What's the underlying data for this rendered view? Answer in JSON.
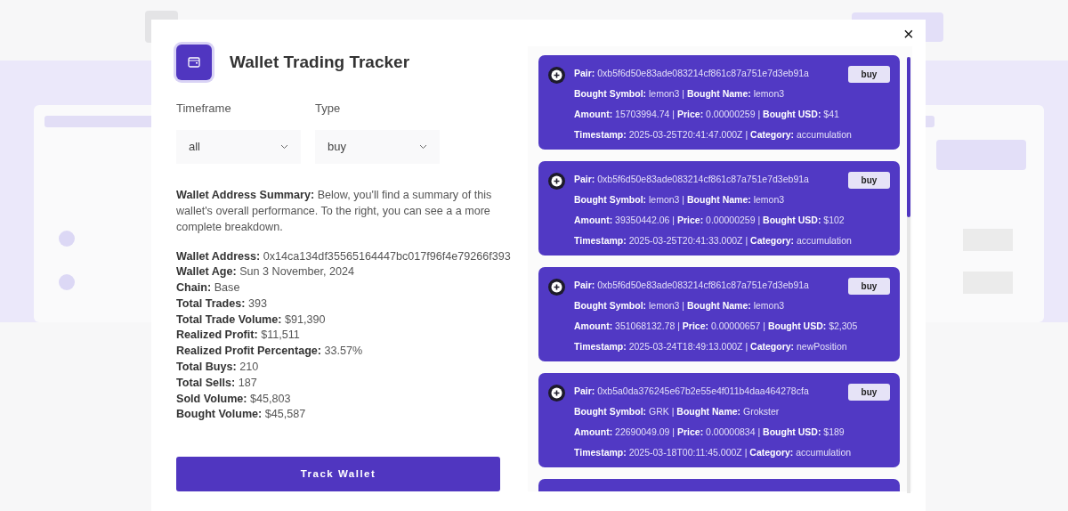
{
  "modal": {
    "title": "Wallet Trading Tracker",
    "filters": [
      {
        "label": "Timeframe",
        "value": "all"
      },
      {
        "label": "Type",
        "value": "buy"
      }
    ],
    "summary": "**Wallet Address Summary:** Below, you'll find a summary of this wallet's overall performance. To the right, you can see a a more complete breakdown.",
    "stats": [
      {
        "label": "Wallet Address:",
        "value": "0x14ca134df35565164447bc017f96f4e79266f393"
      },
      {
        "label": "Wallet Age:",
        "value": "Sun 3 November, 2024"
      },
      {
        "label": "Chain:",
        "value": "Base"
      },
      {
        "label": "Total Trades:",
        "value": "393"
      },
      {
        "label": "Total Trade Volume:",
        "value": "$91,390"
      },
      {
        "label": "Realized Profit:",
        "value": "$11,511"
      },
      {
        "label": "Realized Profit Percentage:",
        "value": "33.57%"
      },
      {
        "label": "Total Buys:",
        "value": "210"
      },
      {
        "label": "Total Sells:",
        "value": "187"
      },
      {
        "label": "Sold Volume:",
        "value": "$45,803"
      },
      {
        "label": "Bought Volume:",
        "value": "$45,587"
      }
    ],
    "action": "Track Wallet",
    "close": "×",
    "trades": [
      {
        "kind": "full",
        "badge": "buy",
        "lines": [
          "**Pair:** 0xb5f6d50e83ade083214cf861c87a751e7d3eb91a",
          "**Bought Symbol:** lemon3 | **Bought Name:** lemon3",
          "**Amount:** 15703994.74 | **Price:** 0.00000259 | **Bought USD:** $41",
          "**Timestamp:** 2025-03-25T20:41:47.000Z | **Category:** accumulation"
        ]
      },
      {
        "kind": "full",
        "badge": "buy",
        "lines": [
          "**Pair:** 0xb5f6d50e83ade083214cf861c87a751e7d3eb91a",
          "**Bought Symbol:** lemon3 | **Bought Name:** lemon3",
          "**Amount:** 39350442.06 | **Price:** 0.00000259 | **Bought USD:** $102",
          "**Timestamp:** 2025-03-25T20:41:33.000Z | **Category:** accumulation"
        ]
      },
      {
        "kind": "full",
        "badge": "buy",
        "lines": [
          "**Pair:** 0xb5f6d50e83ade083214cf861c87a751e7d3eb91a",
          "**Bought Symbol:** lemon3 | **Bought Name:** lemon3",
          "**Amount:** 351068132.78 | **Price:** 0.00000657 | **Bought USD:** $2,305",
          "**Timestamp:** 2025-03-24T18:49:13.000Z | **Category:** newPosition"
        ]
      },
      {
        "kind": "full",
        "badge": "buy",
        "lines": [
          "**Pair:** 0xb5a0da376245e67b2e55e4f011b4daa464278cfa",
          "**Bought Symbol:** GRK | **Bought Name:** Grokster",
          "**Amount:** 22690049.09 | **Price:** 0.00000834 | **Bought USD:** $189",
          "**Timestamp:** 2025-03-18T00:11:45.000Z | **Category:** accumulation"
        ]
      },
      {
        "kind": "cut"
      }
    ]
  }
}
